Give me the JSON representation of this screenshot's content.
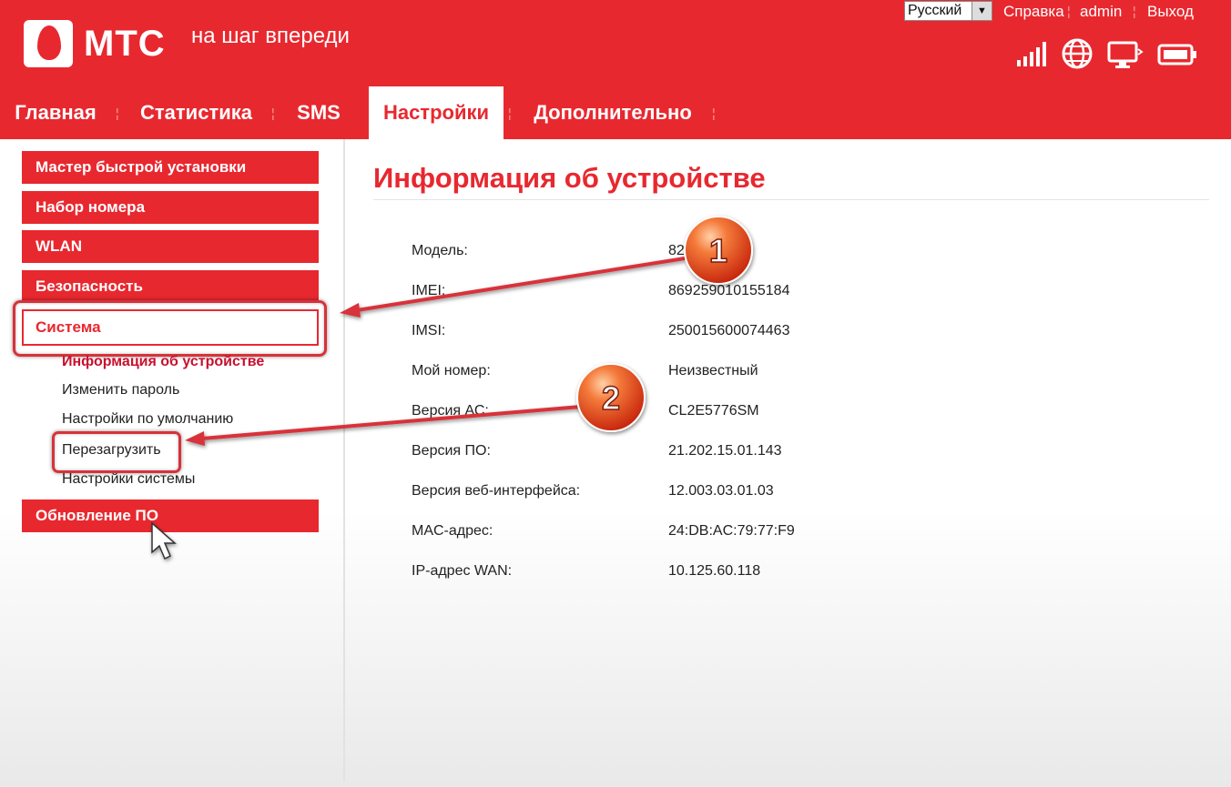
{
  "header": {
    "logo_text": "МТС",
    "slogan": "на шаг впереди",
    "language": "Русский",
    "links": {
      "help": "Справка",
      "user": "admin",
      "logout": "Выход"
    },
    "status_icons": [
      "signal-icon",
      "globe-icon",
      "display-icon",
      "battery-icon"
    ]
  },
  "nav": {
    "tabs": [
      "Главная",
      "Статистика",
      "SMS",
      "Настройки",
      "Дополнительно"
    ],
    "active": "Настройки"
  },
  "sidebar": {
    "items": [
      "Мастер быстрой установки",
      "Набор номера",
      "WLAN",
      "Безопасность",
      "Система",
      "Обновление ПО"
    ],
    "submenu": [
      "Информация об устройстве",
      "Изменить пароль",
      "Настройки по умолчанию",
      "Перезагрузить",
      "Настройки системы"
    ],
    "active_submenu": "Информация об устройстве"
  },
  "main": {
    "title": "Информация об устройстве",
    "rows": [
      {
        "label": "Модель:",
        "value": "82"
      },
      {
        "label": "IMEI:",
        "value": "869259010155184"
      },
      {
        "label": "IMSI:",
        "value": "250015600074463"
      },
      {
        "label": "Мой номер:",
        "value": "Неизвестный"
      },
      {
        "label": "Версия АС:",
        "value": "CL2E5776SM"
      },
      {
        "label": "Версия ПО:",
        "value": "21.202.15.01.143"
      },
      {
        "label": "Версия веб-интерфейса:",
        "value": "12.003.03.01.03"
      },
      {
        "label": "MAC-адрес:",
        "value": "24:DB:AC:79:77:F9"
      },
      {
        "label": "IP-адрес WAN:",
        "value": "10.125.60.118"
      }
    ]
  },
  "annotations": {
    "step1": "1",
    "step2": "2"
  },
  "colors": {
    "brand_red": "#e8282f",
    "white": "#ffffff"
  }
}
